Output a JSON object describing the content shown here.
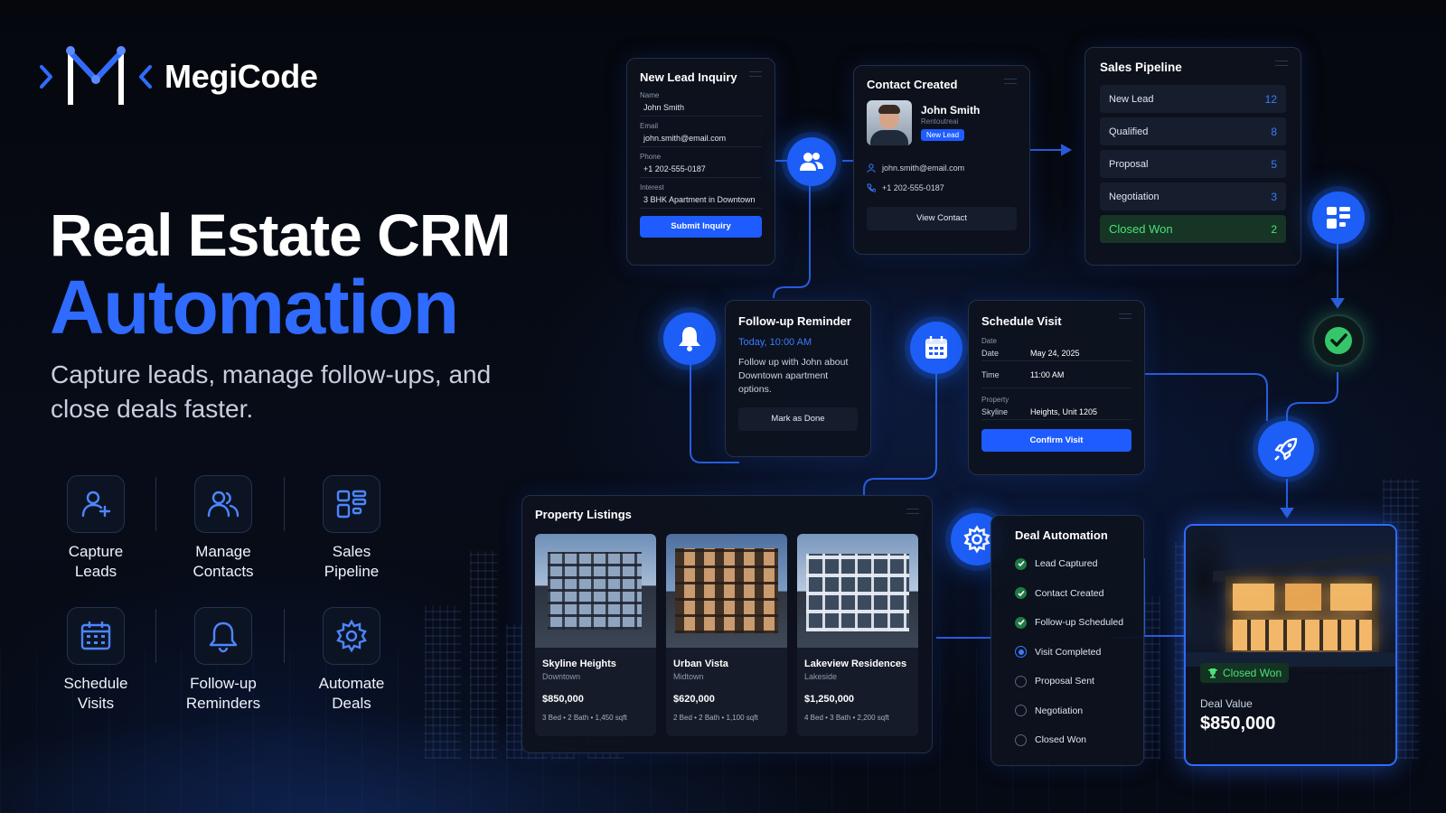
{
  "brand": {
    "name": "MegiCode"
  },
  "hero": {
    "line1": "Real Estate CRM",
    "line2": "Automation",
    "subtitle": "Capture leads, manage follow-ups, and close deals faster."
  },
  "features": [
    {
      "label": "Capture\nLeads",
      "icon": "user-plus-icon"
    },
    {
      "label": "Manage\nContacts",
      "icon": "users-icon"
    },
    {
      "label": "Sales\nPipeline",
      "icon": "pipeline-icon"
    },
    {
      "label": "Schedule\nVisits",
      "icon": "calendar-icon"
    },
    {
      "label": "Follow-up\nReminders",
      "icon": "bell-icon"
    },
    {
      "label": "Automate\nDeals",
      "icon": "gear-icon"
    }
  ],
  "lead_form": {
    "title": "New Lead Inquiry",
    "fields": [
      {
        "label": "Name",
        "value": "John Smith"
      },
      {
        "label": "Email",
        "value": "john.smith@email.com"
      },
      {
        "label": "Phone",
        "value": "+1 202-555-0187"
      },
      {
        "label": "Interest",
        "value": "3 BHK Apartment in Downtown"
      }
    ],
    "submit_label": "Submit Inquiry"
  },
  "contact": {
    "title": "Contact Created",
    "name": "John Smith",
    "subtitle": "Rentoutreai",
    "badge": "New Lead",
    "email": "john.smith@email.com",
    "phone": "+1 202-555-0187",
    "button": "View Contact"
  },
  "pipeline": {
    "title": "Sales Pipeline",
    "stages": [
      {
        "label": "New Lead",
        "count": "12"
      },
      {
        "label": "Qualified",
        "count": "8"
      },
      {
        "label": "Proposal",
        "count": "5"
      },
      {
        "label": "Negotiation",
        "count": "3"
      },
      {
        "label": "Closed Won",
        "count": "2"
      }
    ]
  },
  "followup": {
    "title": "Follow-up Reminder",
    "time": "Today, 10:00 AM",
    "text": "Follow up with John about Downtown apartment options.",
    "button": "Mark as Done"
  },
  "visit": {
    "title": "Schedule Visit",
    "section_date": "Date",
    "date_label": "Date",
    "date_value": "May 24, 2025",
    "time_label": "Time",
    "time_value": "11:00 AM",
    "section_property": "Property",
    "property_label": "Skyline",
    "property_value": "Heights, Unit 1205",
    "button": "Confirm Visit"
  },
  "listings": {
    "title": "Property Listings",
    "items": [
      {
        "name": "Skyline Heights",
        "location": "Downtown",
        "price": "$850,000",
        "details": "3 Bed • 2 Bath • 1,450 sqft"
      },
      {
        "name": "Urban Vista",
        "location": "Midtown",
        "price": "$620,000",
        "details": "2 Bed • 2 Bath • 1,100 sqft"
      },
      {
        "name": "Lakeview Residences",
        "location": "Lakeside",
        "price": "$1,250,000",
        "details": "4 Bed • 3 Bath • 2,200 sqft"
      }
    ]
  },
  "automation": {
    "title": "Deal Automation",
    "steps": [
      {
        "label": "Lead Captured",
        "state": "done"
      },
      {
        "label": "Contact Created",
        "state": "done"
      },
      {
        "label": "Follow-up Scheduled",
        "state": "done"
      },
      {
        "label": "Visit Completed",
        "state": "active"
      },
      {
        "label": "Proposal Sent",
        "state": "pending"
      },
      {
        "label": "Negotiation",
        "state": "pending"
      },
      {
        "label": "Closed Won",
        "state": "pending"
      }
    ]
  },
  "deal": {
    "badge": "Closed Won",
    "label": "Deal Value",
    "value": "$850,000"
  },
  "colors": {
    "accent": "#2f6bff",
    "node": "#1d5ef7",
    "success": "#4be07a",
    "background": "#05080f"
  }
}
